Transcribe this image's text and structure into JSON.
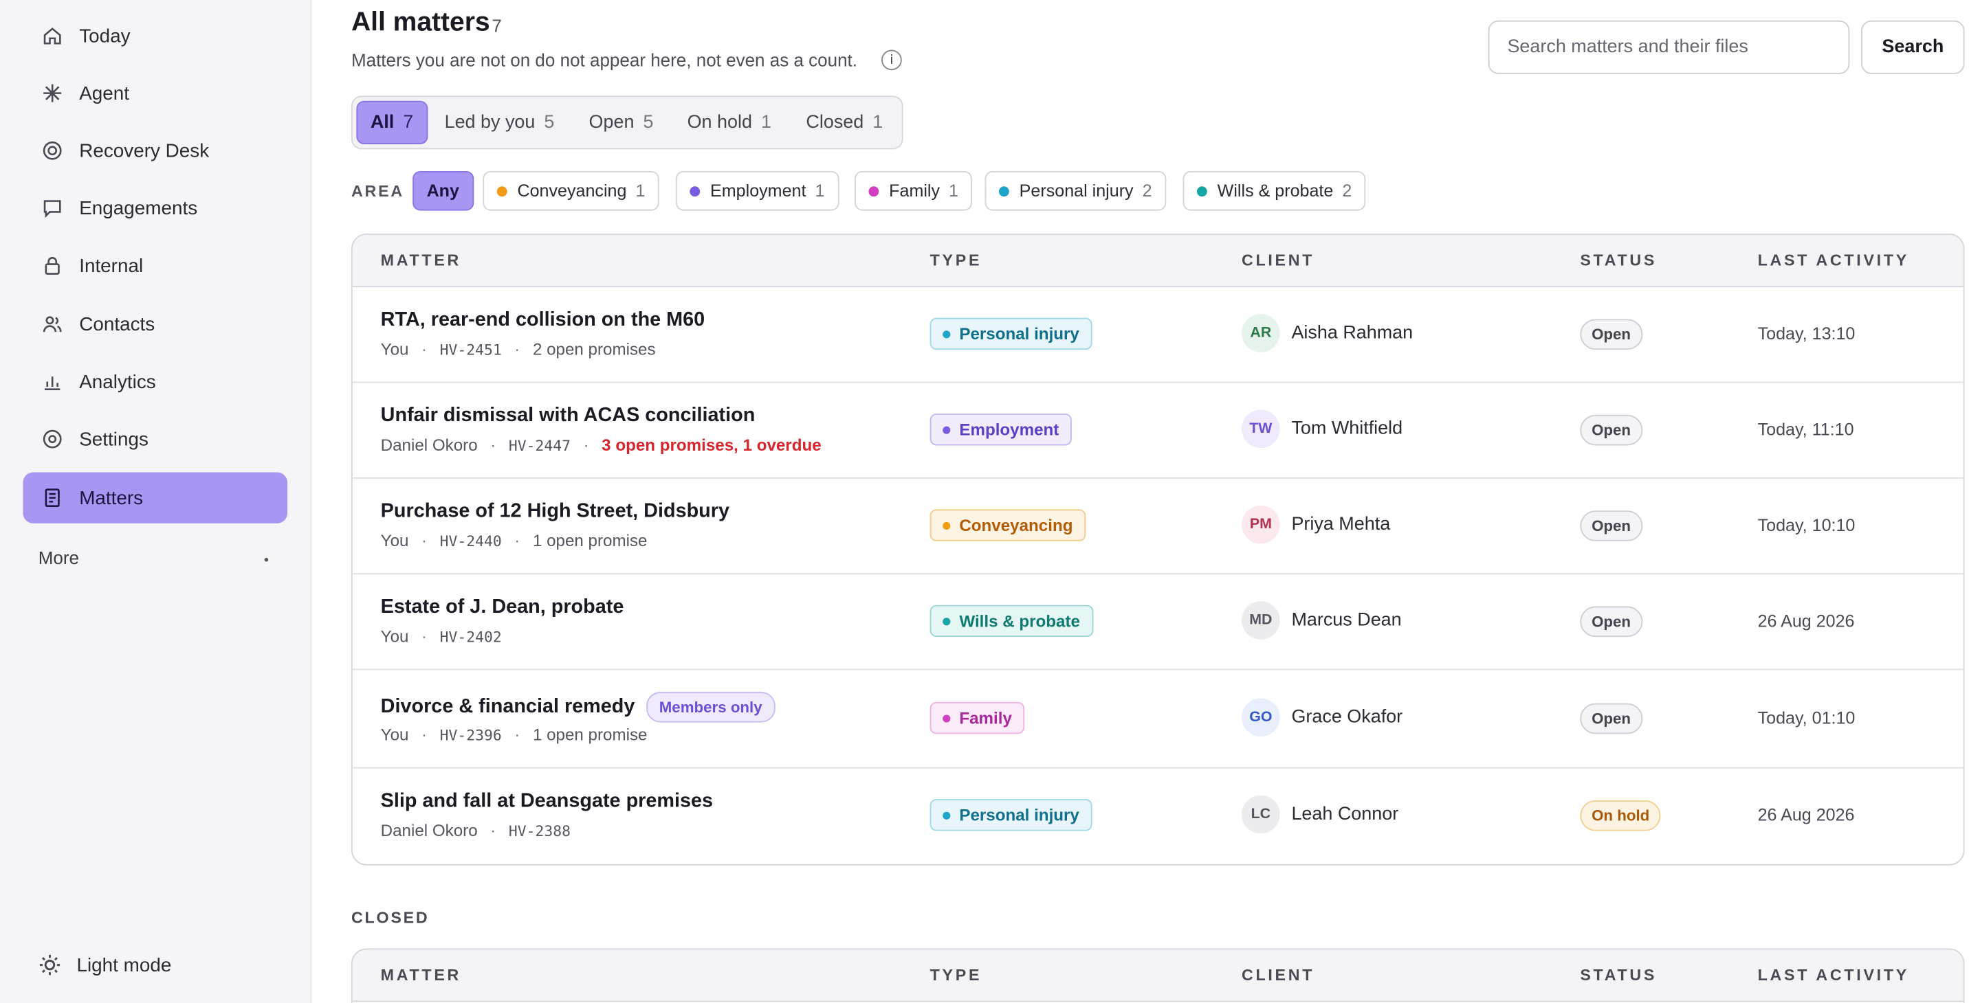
{
  "sidebar": {
    "items": [
      {
        "label": "Today",
        "icon": "home-icon"
      },
      {
        "label": "Agent",
        "icon": "sparkle-icon"
      },
      {
        "label": "Recovery Desk",
        "icon": "target-icon"
      },
      {
        "label": "Engagements",
        "icon": "chat-bubble-icon"
      },
      {
        "label": "Internal",
        "icon": "lock-icon"
      },
      {
        "label": "Contacts",
        "icon": "people-icon"
      },
      {
        "label": "Analytics",
        "icon": "bar-chart-icon"
      },
      {
        "label": "Settings",
        "icon": "gear-icon"
      },
      {
        "label": "Matters",
        "icon": "document-icon",
        "active": true
      }
    ],
    "more_label": "More",
    "light_mode_label": "Light mode"
  },
  "header": {
    "title": "All matters",
    "count": "7",
    "subtitle": "Matters you are not on do not appear here, not even as a count.",
    "info_glyph": "i",
    "search_placeholder": "Search matters and their files",
    "search_button": "Search"
  },
  "tabs": [
    {
      "label": "All",
      "count": "7",
      "active": true
    },
    {
      "label": "Led by you",
      "count": "5"
    },
    {
      "label": "Open",
      "count": "5"
    },
    {
      "label": "On hold",
      "count": "1"
    },
    {
      "label": "Closed",
      "count": "1"
    }
  ],
  "area": {
    "label": "AREA",
    "any_label": "Any",
    "chips": [
      {
        "label": "Conveyancing",
        "count": "1",
        "color": "#f29b17"
      },
      {
        "label": "Employment",
        "count": "1",
        "color": "#7a5ce0"
      },
      {
        "label": "Family",
        "count": "1",
        "color": "#d23fc0"
      },
      {
        "label": "Personal injury",
        "count": "2",
        "color": "#1ea5c9"
      },
      {
        "label": "Wills & probate",
        "count": "2",
        "color": "#17a6a6"
      }
    ]
  },
  "table": {
    "headers": [
      "MATTER",
      "TYPE",
      "CLIENT",
      "STATUS",
      "LAST ACTIVITY"
    ],
    "rows": [
      {
        "title": "RTA, rear-end collision on the M60",
        "lead": "You",
        "code": "HV-2451",
        "promises": "2 open promises",
        "type": "Personal injury",
        "initials": "AR",
        "client": "Aisha Rahman",
        "status": "Open",
        "activity": "Today, 13:10"
      },
      {
        "title": "Unfair dismissal with ACAS conciliation",
        "lead": "Daniel Okoro",
        "code": "HV-2447",
        "promises": "3 open promises, 1 overdue",
        "type": "Employment",
        "initials": "TW",
        "client": "Tom Whitfield",
        "status": "Open",
        "activity": "Today, 11:10"
      },
      {
        "title": "Purchase of 12 High Street, Didsbury",
        "lead": "You",
        "code": "HV-2440",
        "promises": "1 open promise",
        "type": "Conveyancing",
        "initials": "PM",
        "client": "Priya Mehta",
        "status": "Open",
        "activity": "Today, 10:10"
      },
      {
        "title": "Estate of J. Dean, probate",
        "lead": "You",
        "code": "HV-2402",
        "type": "Wills & probate",
        "initials": "MD",
        "client": "Marcus Dean",
        "status": "Open",
        "activity": "26 Aug 2026"
      },
      {
        "title": "Divorce & financial remedy",
        "badge": "Members only",
        "lead": "You",
        "code": "HV-2396",
        "promises": "1 open promise",
        "type": "Family",
        "initials": "GO",
        "client": "Grace Okafor",
        "status": "Open",
        "activity": "Today, 01:10"
      },
      {
        "title": "Slip and fall at Deansgate premises",
        "lead": "Daniel Okoro",
        "code": "HV-2388",
        "type": "Personal injury",
        "initials": "LC",
        "client": "Leah Connor",
        "status": "On hold",
        "activity": "26 Aug 2026"
      }
    ]
  },
  "closed": {
    "label": "CLOSED",
    "headers": [
      "MATTER",
      "TYPE",
      "CLIENT",
      "STATUS",
      "LAST ACTIVITY"
    ]
  }
}
